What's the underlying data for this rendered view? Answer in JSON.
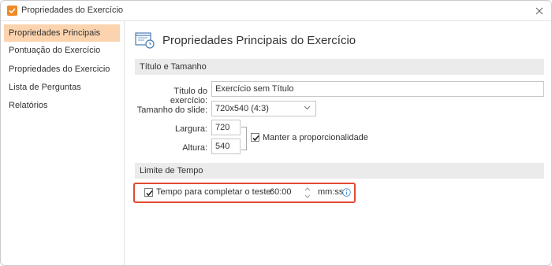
{
  "window": {
    "title": "Propriedades do Exercício"
  },
  "sidebar": {
    "items": [
      {
        "label": "Propriedades Principais",
        "active": true
      },
      {
        "label": "Pontuação do Exercício",
        "active": false
      },
      {
        "label": "Propriedades do Exercicio",
        "active": false
      },
      {
        "label": "Lista de Perguntas",
        "active": false
      },
      {
        "label": "Relatórios",
        "active": false
      }
    ]
  },
  "main": {
    "title": "Propriedades Principais do Exercício",
    "section_title_size": "Título e Tamanho",
    "exercise_title_label": "Título do exercício:",
    "exercise_title_value": "Exercício sem Título",
    "slide_size_label": "Tamanho do slide:",
    "slide_size_value": "720x540 (4:3)",
    "width_label": "Largura:",
    "width_value": "720",
    "height_label": "Altura:",
    "height_value": "540",
    "keep_ratio_label": "Manter a proporcionalidade",
    "keep_ratio_checked": true,
    "section_time_limit": "Limite de Tempo",
    "time_limit_label": "Tempo para completar o teste:",
    "time_limit_checked": true,
    "time_limit_value": "60:00",
    "time_unit": "mm:ss"
  },
  "colors": {
    "accent": "#f08a24",
    "nav_active_bg": "#fbd3ae",
    "section_bg": "#ebebeb",
    "highlight_border": "#e04b33",
    "info_blue": "#4a90d9"
  }
}
